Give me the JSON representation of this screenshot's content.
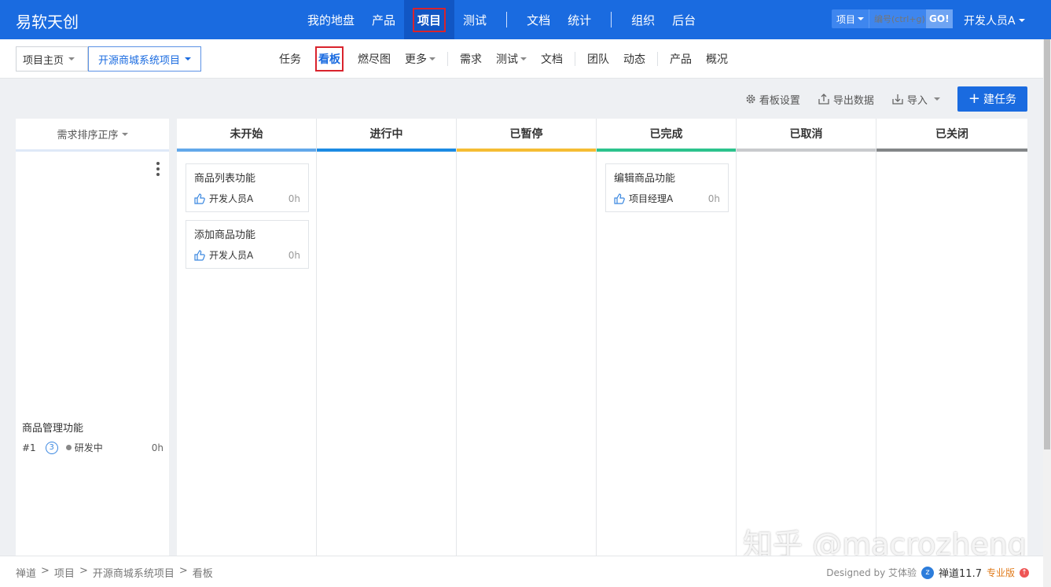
{
  "header": {
    "brand": "易软天创",
    "nav": [
      {
        "label": "我的地盘"
      },
      {
        "label": "产品"
      },
      {
        "label": "项目"
      },
      {
        "label": "测试"
      },
      {
        "label": "文档"
      },
      {
        "label": "统计"
      },
      {
        "label": "组织"
      },
      {
        "label": "后台"
      }
    ],
    "search_type": "项目",
    "search_placeholder": "编号(ctrl+g)",
    "go_label": "GO!",
    "user": "开发人员A"
  },
  "subbar": {
    "crumb_home": "项目主页",
    "crumb_project": "开源商城系统项目",
    "tabs": [
      {
        "label": "任务"
      },
      {
        "label": "看板"
      },
      {
        "label": "燃尽图"
      },
      {
        "label": "更多"
      },
      {
        "label": "需求"
      },
      {
        "label": "测试"
      },
      {
        "label": "文档"
      },
      {
        "label": "团队"
      },
      {
        "label": "动态"
      },
      {
        "label": "产品"
      },
      {
        "label": "概况"
      }
    ]
  },
  "toolbar": {
    "settings": "看板设置",
    "export": "导出数据",
    "import": "导入",
    "create": "建任务"
  },
  "left": {
    "sort_label": "需求排序正序",
    "story": {
      "title": "商品管理功能",
      "id": "#1",
      "priority": "3",
      "status": "研发中",
      "hours": "0h"
    }
  },
  "columns": [
    {
      "name": "未开始",
      "color": "#62a8ea"
    },
    {
      "name": "进行中",
      "color": "#1c8be3"
    },
    {
      "name": "已暂停",
      "color": "#f5bd34"
    },
    {
      "name": "已完成",
      "color": "#2cc38d"
    },
    {
      "name": "已取消",
      "color": "#c8cacd"
    },
    {
      "name": "已关闭",
      "color": "#838688"
    }
  ],
  "cards": {
    "todo1": {
      "title": "商品列表功能",
      "owner": "开发人员A",
      "hours": "0h"
    },
    "todo2": {
      "title": "添加商品功能",
      "owner": "开发人员A",
      "hours": "0h"
    },
    "done1": {
      "title": "编辑商品功能",
      "owner": "项目经理A",
      "hours": "0h"
    }
  },
  "footer": {
    "crumbs": [
      "禅道",
      ">",
      "项目",
      ">",
      "开源商城系统项目",
      ">",
      "看板"
    ],
    "designed_by": "Designed by 艾体验",
    "version": "禅道11.7",
    "edition": "专业版"
  },
  "watermark": "知乎 @macrozheng"
}
